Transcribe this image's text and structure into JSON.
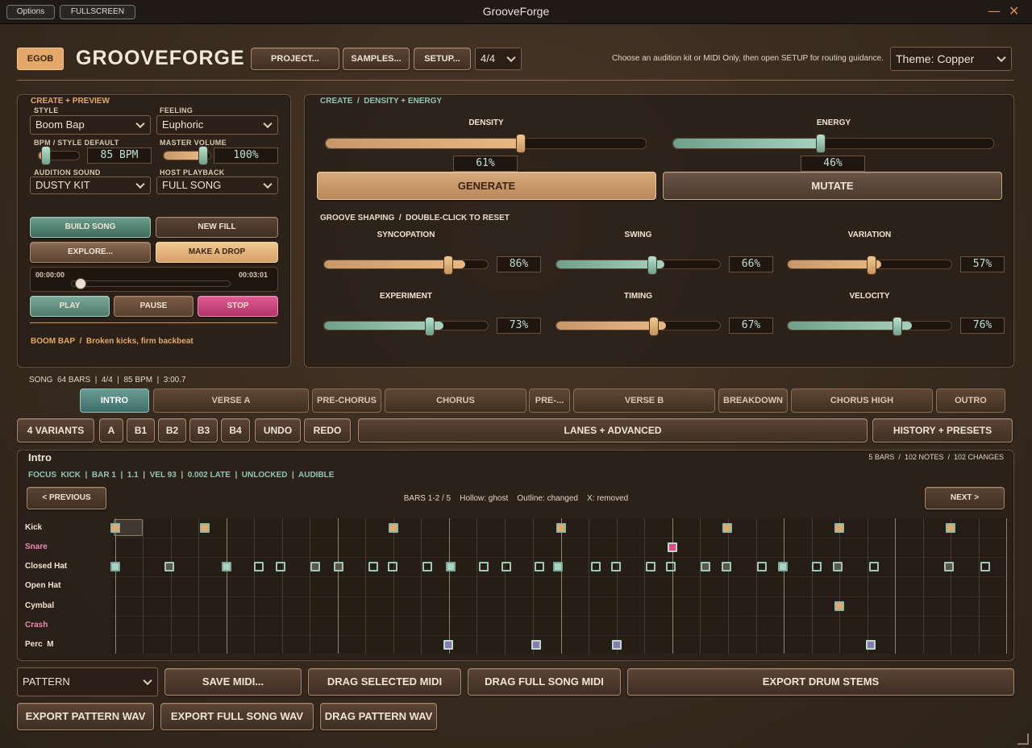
{
  "window": {
    "title": "GrooveForge",
    "options_label": "Options",
    "fullscreen_label": "FULLSCREEN",
    "minimize_glyph": "—",
    "close_glyph": "✕"
  },
  "header": {
    "badge": "EGOB",
    "app_name": "GROOVEFORGE",
    "project_label": "PROJECT...",
    "samples_label": "SAMPLES...",
    "setup_label": "SETUP...",
    "time_signature": "4/4",
    "hint": "Choose an audition kit or MIDI Only, then open SETUP for routing guidance.",
    "theme": "Theme: Copper"
  },
  "create": {
    "section": "CREATE + PREVIEW",
    "style_label": "STYLE",
    "style_value": "Boom Bap",
    "feeling_label": "FEELING",
    "feeling_value": "Euphoric",
    "bpm_label": "BPM / STYLE DEFAULT",
    "bpm_value": "85 BPM",
    "bpm_level": 0.2,
    "master_label": "MASTER VOLUME",
    "master_value": "100%",
    "master_level": 0.83,
    "audition_label": "AUDITION SOUND",
    "audition_value": "DUSTY KIT",
    "host_label": "HOST PLAYBACK",
    "host_value": "FULL SONG",
    "build_song": "BUILD SONG",
    "new_fill": "NEW FILL",
    "explore": "EXPLORE...",
    "make_drop": "MAKE A DROP",
    "time_start": "00:00:00",
    "time_end": "00:03:01",
    "playhead_level": 0.06,
    "play": "PLAY",
    "pause": "PAUSE",
    "stop": "STOP",
    "style_name": "BOOM BAP",
    "style_sep": "/",
    "style_desc": "Broken kicks, firm backbeat"
  },
  "density": {
    "section": "CREATE",
    "section_sep": "/",
    "section_sub": "DENSITY + ENERGY",
    "density_label": "DENSITY",
    "density_value": "61%",
    "density_level": 0.61,
    "energy_label": "ENERGY",
    "energy_value": "46%",
    "energy_level": 0.46,
    "generate": "GENERATE",
    "mutate": "MUTATE"
  },
  "shaping": {
    "section": "GROOVE SHAPING",
    "section_sep": "/",
    "section_sub": "DOUBLE-CLICK TO RESET",
    "sliders": [
      {
        "label": "SYNCOPATION",
        "value": "86%",
        "level": 0.86,
        "color": "copper"
      },
      {
        "label": "SWING",
        "value": "66%",
        "level": 0.66,
        "color": "green"
      },
      {
        "label": "VARIATION",
        "value": "57%",
        "level": 0.57,
        "color": "copper"
      },
      {
        "label": "EXPERIMENT",
        "value": "73%",
        "level": 0.73,
        "color": "green"
      },
      {
        "label": "TIMING",
        "value": "67%",
        "level": 0.67,
        "color": "copper"
      },
      {
        "label": "VELOCITY",
        "value": "76%",
        "level": 0.76,
        "color": "green"
      }
    ]
  },
  "song": {
    "info": "SONG  64 BARS  |  4/4  |  85 BPM  |  3:00.7",
    "sections": [
      "INTRO",
      "VERSE A",
      "PRE-CHORUS",
      "CHORUS",
      "PRE-...",
      "VERSE B",
      "BREAKDOWN",
      "CHORUS HIGH",
      "OUTRO"
    ],
    "active_section": "INTRO"
  },
  "variants": {
    "count": "4 VARIANTS",
    "a": "A",
    "b1": "B1",
    "b2": "B2",
    "b3": "B3",
    "b4": "B4",
    "undo": "UNDO",
    "redo": "REDO",
    "lanes": "LANES + ADVANCED",
    "history": "HISTORY + PRESETS"
  },
  "pattern": {
    "title": "Intro",
    "stats": "5 BARS  /  102 NOTES  /  102 CHANGES",
    "focus": "FOCUS  KICK  |  BAR 1  |  1.1  |  VEL 93  |  0.002 LATE  |  UNLOCKED  |  AUDIBLE",
    "previous": "< PREVIOUS",
    "next": "NEXT >",
    "legend": "BARS 1-2 / 5    Hollow: ghost    Outline: changed    X: removed",
    "lanes": [
      "Kick",
      "Snare",
      "Closed Hat",
      "Open Hat",
      "Cymbal",
      "Crash",
      "Perc  M"
    ]
  },
  "footer": {
    "pattern_mode": "PATTERN",
    "save_midi": "SAVE MIDI...",
    "drag_selected_midi": "DRAG SELECTED MIDI",
    "drag_full_song_midi": "DRAG FULL SONG MIDI",
    "export_drum_stems": "EXPORT DRUM STEMS",
    "export_pattern_wav": "EXPORT PATTERN WAV",
    "export_full_song_wav": "EXPORT FULL SONG WAV",
    "drag_pattern_wav": "DRAG PATTERN WAV"
  }
}
